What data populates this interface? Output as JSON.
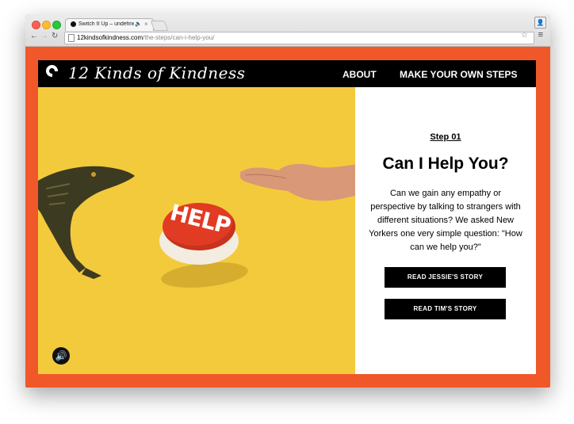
{
  "browser": {
    "tab_title": "Switch It Up – undefine",
    "tab_audio_icon": "speaker-icon",
    "tab_close_icon": "close-icon",
    "url_host": "12kindsofkindness.com",
    "url_path": "/the-steps/can-i-help-you/",
    "nav_back": "back-arrow-icon",
    "nav_forward": "forward-arrow-icon",
    "nav_reload": "reload-icon",
    "bookmark_icon": "star-icon",
    "menu_icon": "hamburger-menu-icon",
    "profile_icon": "person-icon"
  },
  "site": {
    "logo_text": "12 Kinds of Kindness",
    "nav": [
      {
        "label": "ABOUT"
      },
      {
        "label": "MAKE YOUR OWN STEPS"
      }
    ],
    "accent_color": "#f0582a",
    "hero_color": "#f3ca3c"
  },
  "hero": {
    "button_text": "HELP",
    "sound_icon": "speaker-icon"
  },
  "step": {
    "label": "Step 01",
    "title": "Can I Help You?",
    "description": "Can we gain any empathy or perspective by talking to strangers with different situations? We asked New Yorkers one very simple question: \"How can we help you?\"",
    "buttons": [
      {
        "label": "READ JESSIE'S STORY"
      },
      {
        "label": "READ TIM'S STORY"
      }
    ]
  }
}
